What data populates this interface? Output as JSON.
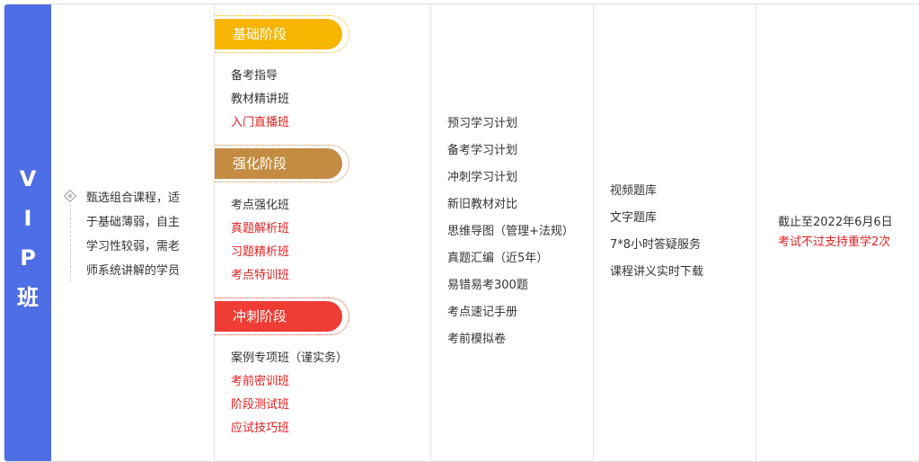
{
  "vip_label": [
    "V",
    "I",
    "P",
    "班"
  ],
  "intro_text": [
    "甄选组合课程，适",
    "于基础薄弱，自主",
    "学习性较弱，需老",
    "师系统讲解的学员"
  ],
  "stages": [
    {
      "title": "基础阶段",
      "color": "#f7b500",
      "items": [
        {
          "label": "备考指导",
          "highlight": false
        },
        {
          "label": "教材精讲班",
          "highlight": false
        },
        {
          "label": "入门直播班",
          "highlight": true
        }
      ]
    },
    {
      "title": "强化阶段",
      "color": "#c48c42",
      "items": [
        {
          "label": "考点强化班",
          "highlight": false
        },
        {
          "label": "真题解析班",
          "highlight": true
        },
        {
          "label": "习题精析班",
          "highlight": true
        },
        {
          "label": "考点特训班",
          "highlight": true
        }
      ]
    },
    {
      "title": "冲刺阶段",
      "color": "#ef3c35",
      "items": [
        {
          "label": "案例专项班（谨实务）",
          "highlight": false
        },
        {
          "label": "考前密训班",
          "highlight": true
        },
        {
          "label": "阶段测试班",
          "highlight": true
        },
        {
          "label": "应试技巧班",
          "highlight": true
        }
      ]
    }
  ],
  "study_materials": [
    "预习学习计划",
    "备考学习计划",
    "冲刺学习计划",
    "新旧教材对比",
    "思维导图（管理+法规）",
    "真题汇编（近5年）",
    "易错易考300题",
    "考点速记手册",
    "考前模拟卷"
  ],
  "services": [
    "视频题库",
    "文字题库",
    "7*8小时答疑服务",
    "课程讲义实时下载"
  ],
  "validity": {
    "deadline": "截止至2022年6月6日",
    "retake": "考试不过支持重学2次"
  },
  "colors": {
    "vip_bg": "#4e6ee6",
    "highlight": "#e02020"
  }
}
